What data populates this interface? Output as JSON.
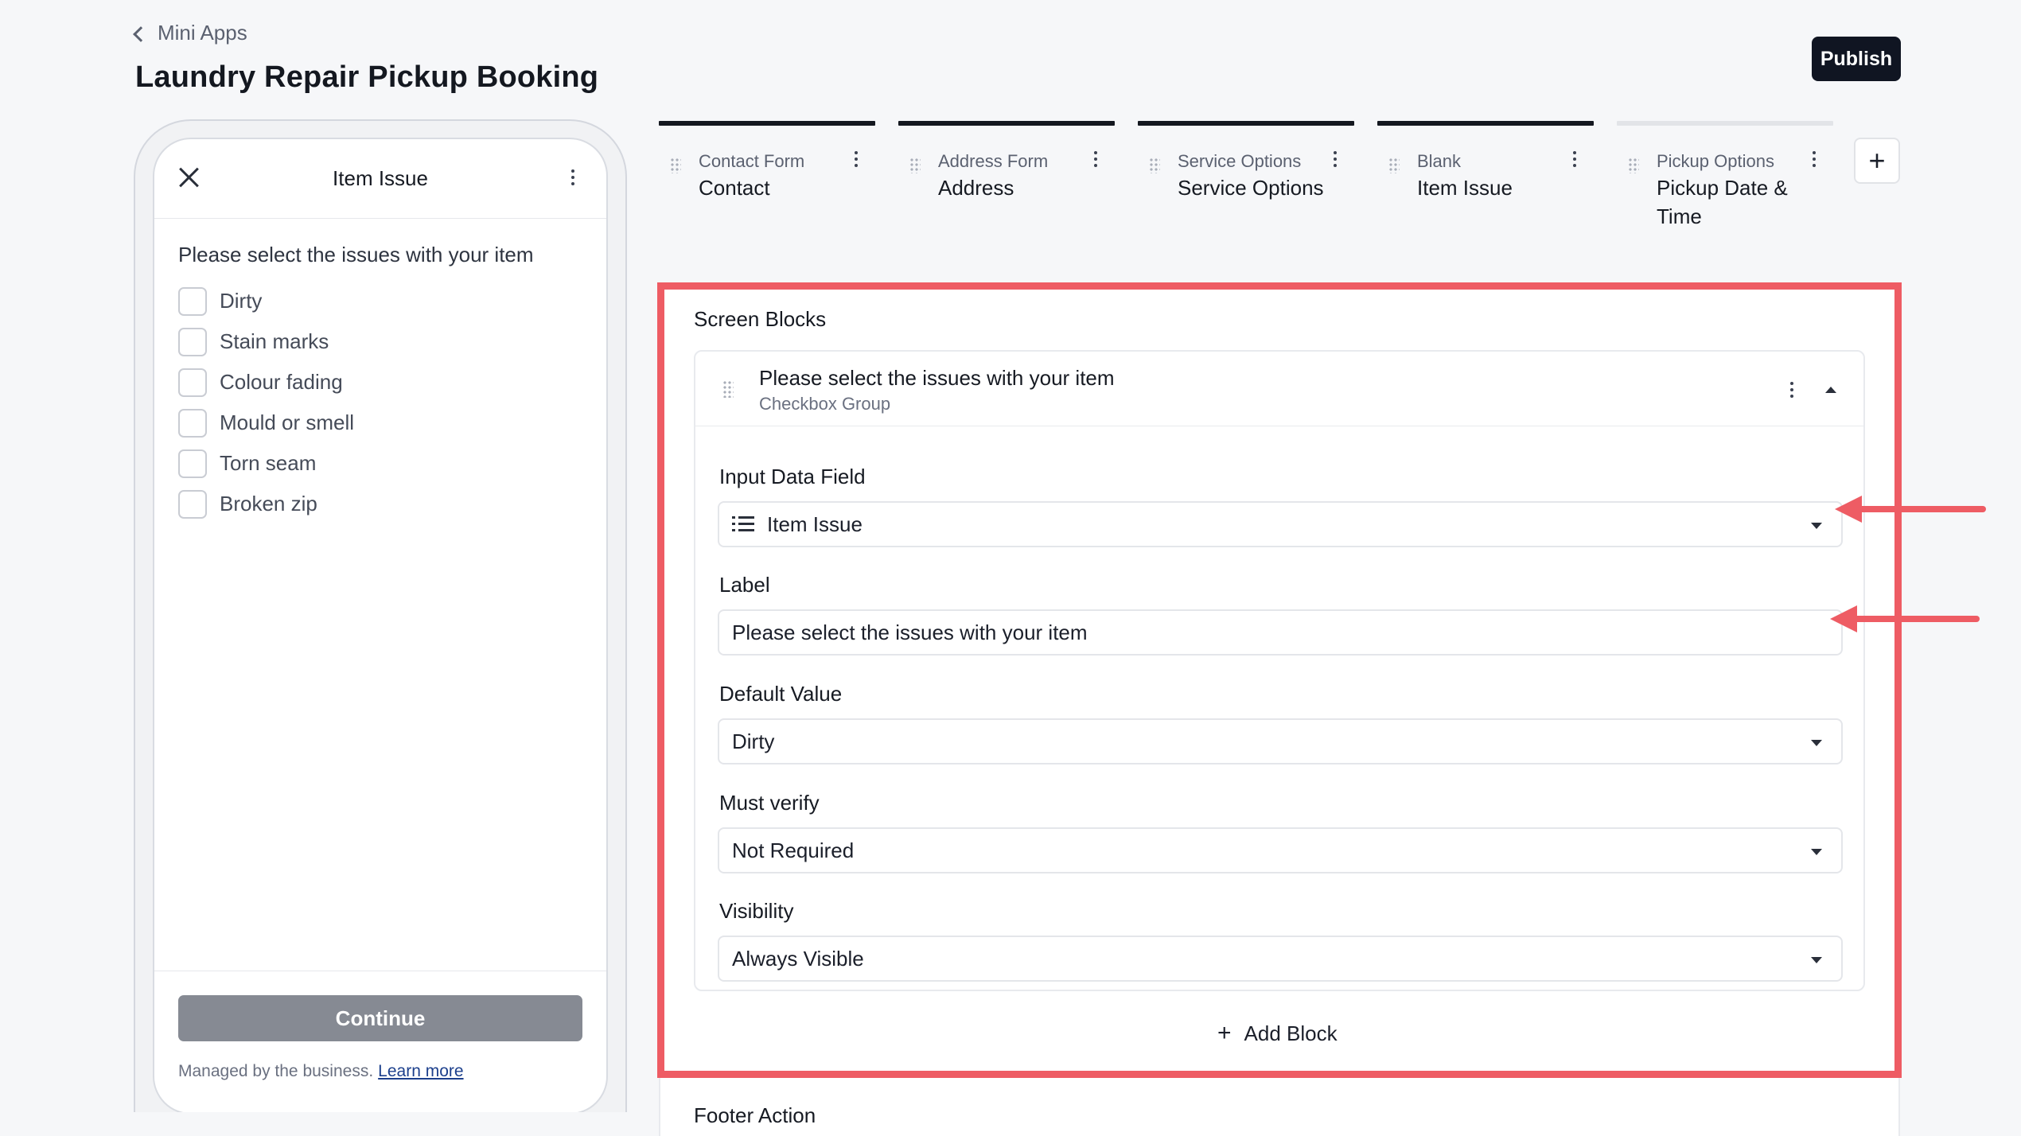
{
  "header": {
    "back_label": "Mini Apps",
    "title": "Laundry Repair Pickup Booking",
    "publish_label": "Publish"
  },
  "phone": {
    "title": "Item Issue",
    "question": "Please select the issues with your item",
    "options": [
      "Dirty",
      "Stain marks",
      "Colour fading",
      "Mould or smell",
      "Torn seam",
      "Broken zip"
    ],
    "continue_label": "Continue",
    "managed_text": "Managed by the business.",
    "learn_more": "Learn more"
  },
  "steps": [
    {
      "type": "Contact Form",
      "name": "Contact",
      "active": true
    },
    {
      "type": "Address Form",
      "name": "Address",
      "active": true
    },
    {
      "type": "Service Options",
      "name": "Service Options",
      "active": true
    },
    {
      "type": "Blank",
      "name": "Item Issue",
      "active": true
    },
    {
      "type": "Pickup Options",
      "name": "Pickup Date & Time",
      "active": false
    }
  ],
  "add_step_label": "+",
  "screen_blocks": {
    "title": "Screen Blocks",
    "block": {
      "title": "Please select the issues with your item",
      "type": "Checkbox Group",
      "input_data_field_label": "Input Data Field",
      "input_data_field_value": "Item Issue",
      "label_label": "Label",
      "label_value": "Please select the issues with your item",
      "default_value_label": "Default Value",
      "default_value": "Dirty",
      "must_verify_label": "Must verify",
      "must_verify_value": "Not Required",
      "visibility_label": "Visibility",
      "visibility_value": "Always Visible"
    },
    "add_block_label": "Add Block"
  },
  "footer_action_title": "Footer Action",
  "colors": {
    "highlight": "#ee5c64",
    "primary": "#101522",
    "continue_disabled": "#868a93",
    "link": "#1c3f8c"
  }
}
